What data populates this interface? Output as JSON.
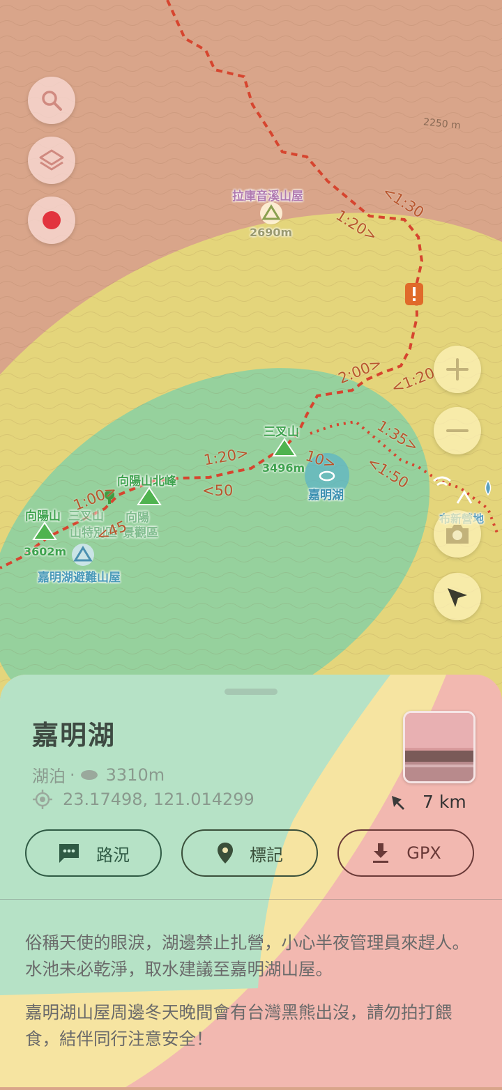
{
  "map": {
    "labels": {
      "hut_lakuyinxi": "拉庫音溪山屋",
      "hut_lakuyinxi_elev": "2690m",
      "peak_sancha": "三叉山",
      "peak_sancha_elev": "3496m",
      "lake": "嘉明湖",
      "peak_xiangyang_north": "向陽山北峰",
      "peak_xiangyang": "向陽山",
      "peak_xiangyang_elev": "3602m",
      "hut_jiaming": "嘉明湖避難山屋",
      "camp_area_1": "三叉山",
      "camp_area_2": "山特別區",
      "camp_area_3": "向陽",
      "camp_area_4": "景觀區",
      "campsite_right": "布新營地",
      "contour_2250": "2250 m"
    },
    "times": {
      "t1": "<1:30",
      "t2": "1:20>",
      "t3": "2:00>",
      "t4": "<1:20",
      "t5": "1:35>",
      "t6": "<1:50",
      "t7": "1:20>",
      "t8": "10>",
      "t9": "<50",
      "t10": "1:00>",
      "t11": "<45"
    },
    "colors": {
      "zone_brown": "#d9a58a",
      "zone_yellow": "#e5d97a",
      "zone_green": "#8fd0a0",
      "trail": "#d6452f"
    },
    "controls": {
      "search": "search-icon",
      "layers": "layers-icon",
      "record": "record-icon",
      "zoom_in": "plus-icon",
      "zoom_out": "minus-icon",
      "camera": "camera-icon",
      "locate": "navigation-arrow-icon"
    }
  },
  "sheet": {
    "title": "嘉明湖",
    "category": "湖泊",
    "separator": "·",
    "elevation": "3310m",
    "coordinates": "23.17498, 121.014299",
    "distance": "7 km",
    "buttons": {
      "conditions": "路況",
      "mark": "標記",
      "gpx": "GPX"
    },
    "description_1": "俗稱天使的眼淚，湖邊禁止扎營，小心半夜管理員來趕人。水池未必乾淨，取水建議至嘉明湖山屋。",
    "description_2": "嘉明湖山屋周邊冬天晚間會有台灣黑熊出沒，請勿拍打餵食，結伴同行注意安全！"
  }
}
